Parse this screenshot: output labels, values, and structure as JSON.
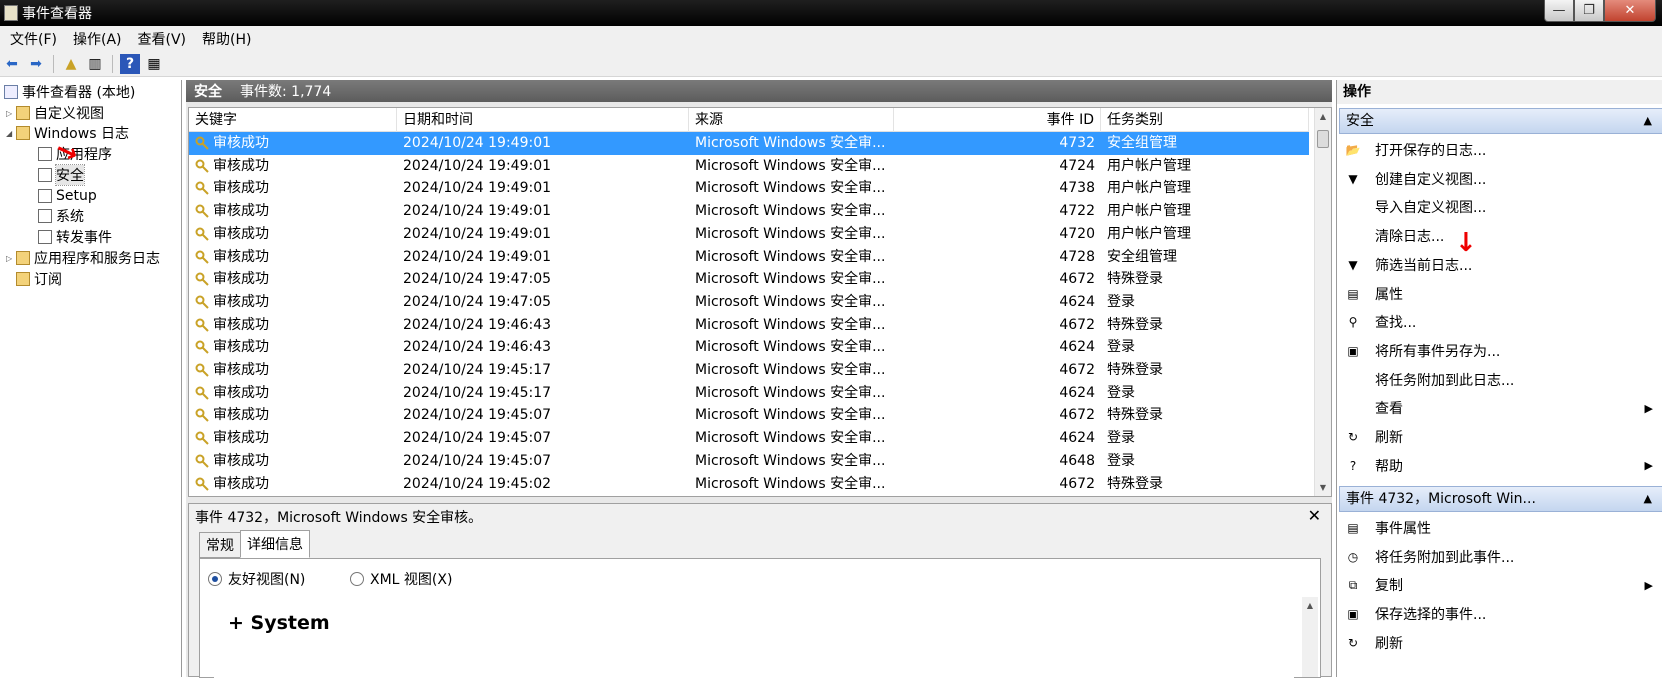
{
  "window": {
    "title": "事件查看器",
    "min": "—",
    "max": "❐",
    "close": "✕"
  },
  "menu": [
    "文件(F)",
    "操作(A)",
    "查看(V)",
    "帮助(H)"
  ],
  "tree": {
    "root": "事件查看器 (本地)",
    "custom_views": "自定义视图",
    "windows_logs": "Windows 日志",
    "logs": [
      "应用程序",
      "安全",
      "Setup",
      "系统",
      "转发事件"
    ],
    "app_service_logs": "应用程序和服务日志",
    "subscriptions": "订阅"
  },
  "center": {
    "title": "安全",
    "event_count": "事件数: 1,774",
    "columns": [
      "关键字",
      "日期和时间",
      "来源",
      "事件 ID",
      "任务类别"
    ],
    "rows": [
      {
        "kw": "审核成功",
        "date": "2024/10/24 19:49:01",
        "src": "Microsoft Windows 安全审...",
        "id": "4732",
        "cat": "安全组管理"
      },
      {
        "kw": "审核成功",
        "date": "2024/10/24 19:49:01",
        "src": "Microsoft Windows 安全审...",
        "id": "4724",
        "cat": "用户帐户管理"
      },
      {
        "kw": "审核成功",
        "date": "2024/10/24 19:49:01",
        "src": "Microsoft Windows 安全审...",
        "id": "4738",
        "cat": "用户帐户管理"
      },
      {
        "kw": "审核成功",
        "date": "2024/10/24 19:49:01",
        "src": "Microsoft Windows 安全审...",
        "id": "4722",
        "cat": "用户帐户管理"
      },
      {
        "kw": "审核成功",
        "date": "2024/10/24 19:49:01",
        "src": "Microsoft Windows 安全审...",
        "id": "4720",
        "cat": "用户帐户管理"
      },
      {
        "kw": "审核成功",
        "date": "2024/10/24 19:49:01",
        "src": "Microsoft Windows 安全审...",
        "id": "4728",
        "cat": "安全组管理"
      },
      {
        "kw": "审核成功",
        "date": "2024/10/24 19:47:05",
        "src": "Microsoft Windows 安全审...",
        "id": "4672",
        "cat": "特殊登录"
      },
      {
        "kw": "审核成功",
        "date": "2024/10/24 19:47:05",
        "src": "Microsoft Windows 安全审...",
        "id": "4624",
        "cat": "登录"
      },
      {
        "kw": "审核成功",
        "date": "2024/10/24 19:46:43",
        "src": "Microsoft Windows 安全审...",
        "id": "4672",
        "cat": "特殊登录"
      },
      {
        "kw": "审核成功",
        "date": "2024/10/24 19:46:43",
        "src": "Microsoft Windows 安全审...",
        "id": "4624",
        "cat": "登录"
      },
      {
        "kw": "审核成功",
        "date": "2024/10/24 19:45:17",
        "src": "Microsoft Windows 安全审...",
        "id": "4672",
        "cat": "特殊登录"
      },
      {
        "kw": "审核成功",
        "date": "2024/10/24 19:45:17",
        "src": "Microsoft Windows 安全审...",
        "id": "4624",
        "cat": "登录"
      },
      {
        "kw": "审核成功",
        "date": "2024/10/24 19:45:07",
        "src": "Microsoft Windows 安全审...",
        "id": "4672",
        "cat": "特殊登录"
      },
      {
        "kw": "审核成功",
        "date": "2024/10/24 19:45:07",
        "src": "Microsoft Windows 安全审...",
        "id": "4624",
        "cat": "登录"
      },
      {
        "kw": "审核成功",
        "date": "2024/10/24 19:45:07",
        "src": "Microsoft Windows 安全审...",
        "id": "4648",
        "cat": "登录"
      },
      {
        "kw": "审核成功",
        "date": "2024/10/24 19:45:02",
        "src": "Microsoft Windows 安全审...",
        "id": "4672",
        "cat": "特殊登录"
      }
    ]
  },
  "detail": {
    "title": "事件 4732，Microsoft Windows 安全审核。",
    "tabs": [
      "常规",
      "详细信息"
    ],
    "friendly": "友好视图(N)",
    "xml": "XML 视图(X)",
    "system": "+ System"
  },
  "actions": {
    "header": "操作",
    "section1": "安全",
    "items1": [
      {
        "label": "打开保存的日志...",
        "icon": "📂"
      },
      {
        "label": "创建自定义视图...",
        "icon": "▼"
      },
      {
        "label": "导入自定义视图...",
        "icon": ""
      },
      {
        "label": "清除日志...",
        "icon": ""
      },
      {
        "label": "筛选当前日志...",
        "icon": "▼"
      },
      {
        "label": "属性",
        "icon": "▤"
      },
      {
        "label": "查找...",
        "icon": "⚲"
      },
      {
        "label": "将所有事件另存为...",
        "icon": "▣"
      },
      {
        "label": "将任务附加到此日志...",
        "icon": ""
      },
      {
        "label": "查看",
        "icon": ""
      },
      {
        "label": "刷新",
        "icon": "↻"
      },
      {
        "label": "帮助",
        "icon": "?"
      }
    ],
    "section2": "事件 4732，Microsoft Win...",
    "items2": [
      {
        "label": "事件属性",
        "icon": "▤"
      },
      {
        "label": "将任务附加到此事件...",
        "icon": "◷"
      },
      {
        "label": "复制",
        "icon": "⧉"
      },
      {
        "label": "保存选择的事件...",
        "icon": "▣"
      },
      {
        "label": "刷新",
        "icon": "↻"
      }
    ]
  },
  "colors": {
    "selection": "#3399ff",
    "header": "#666666",
    "section": "#c4d6ef"
  }
}
